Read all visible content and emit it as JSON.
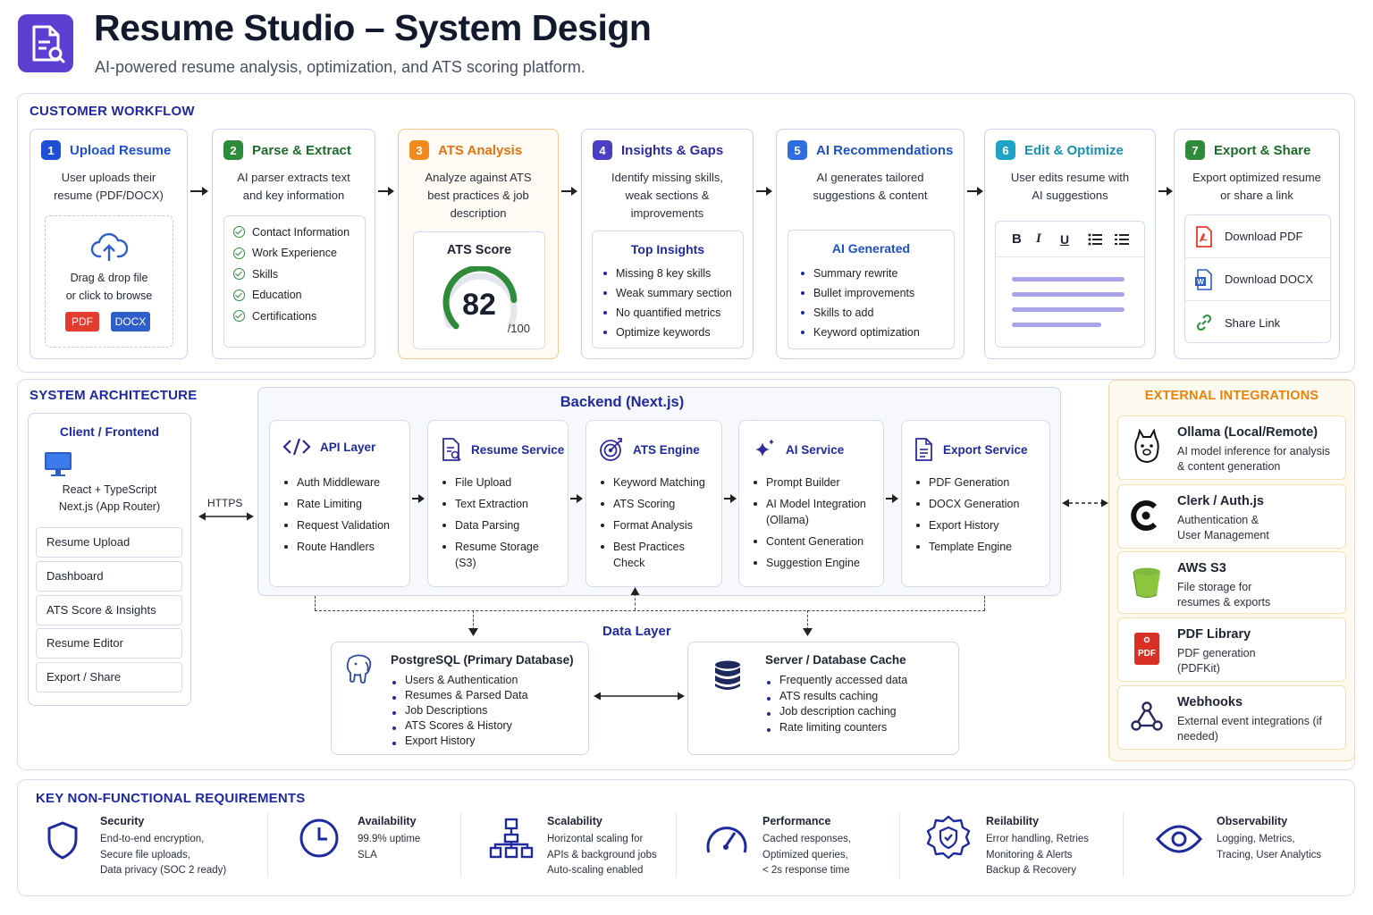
{
  "header": {
    "title": "Resume Studio – System Design",
    "subtitle": "AI-powered resume analysis, optimization, and ATS scoring platform."
  },
  "workflow": {
    "title": "CUSTOMER WORKFLOW",
    "steps": [
      {
        "num": "1",
        "title": "Upload Resume",
        "desc": "User uploads their resume (PDF/DOCX)"
      },
      {
        "num": "2",
        "title": "Parse & Extract",
        "desc": "AI parser extracts text and key information"
      },
      {
        "num": "3",
        "title": "ATS Analysis",
        "desc": "Analyze against ATS best practices & job description"
      },
      {
        "num": "4",
        "title": "Insights & Gaps",
        "desc": "Identify missing skills, weak sections & improvements"
      },
      {
        "num": "5",
        "title": "AI Recommendations",
        "desc": "AI generates tailored suggestions & content"
      },
      {
        "num": "6",
        "title": "Edit & Optimize",
        "desc": "User edits resume with AI suggestions"
      },
      {
        "num": "7",
        "title": "Export & Share",
        "desc": "Export optimized resume or share a link"
      }
    ],
    "upload": {
      "line1": "Drag & drop file",
      "line2": "or click to browse",
      "pdf": "PDF",
      "docx": "DOCX"
    },
    "parse_items": [
      "Contact Information",
      "Work Experience",
      "Skills",
      "Education",
      "Certifications"
    ],
    "ats": {
      "label": "ATS Score",
      "score": "82",
      "max": "/100",
      "fraction": 0.82
    },
    "insights": {
      "title": "Top Insights",
      "items": [
        "Missing 8 key skills",
        "Weak summary section",
        "No quantified metrics",
        "Optimize keywords"
      ]
    },
    "ai_generated": {
      "title": "AI Generated",
      "items": [
        "Summary rewrite",
        "Bullet improvements",
        "Skills to add",
        "Keyword optimization"
      ]
    },
    "editor": {
      "bold": "B",
      "italic": "I",
      "underline": "U"
    },
    "export": {
      "pdf": "Download PDF",
      "docx": "Download DOCX",
      "share": "Share Link",
      "docx_glyph": "W"
    }
  },
  "architecture": {
    "title": "SYSTEM ARCHITECTURE",
    "client": {
      "title": "Client / Frontend",
      "stack1": "React + TypeScript",
      "stack2": "Next.js (App Router)",
      "items": [
        "Resume Upload",
        "Dashboard",
        "ATS Score & Insights",
        "Resume Editor",
        "Export / Share"
      ]
    },
    "https": "HTTPS",
    "backend": {
      "title": "Backend (Next.js)",
      "services": [
        {
          "title": "API Layer",
          "items": [
            "Auth Middleware",
            "Rate Limiting",
            "Request Validation",
            "Route Handlers"
          ]
        },
        {
          "title": "Resume Service",
          "items": [
            "File Upload",
            "Text Extraction",
            "Data Parsing",
            "Resume Storage (S3)"
          ]
        },
        {
          "title": "ATS Engine",
          "items": [
            "Keyword Matching",
            "ATS Scoring",
            "Format Analysis",
            "Best Practices Check"
          ]
        },
        {
          "title": "AI Service",
          "items": [
            "Prompt Builder",
            "AI Model Integration (Ollama)",
            "Content Generation",
            "Suggestion Engine"
          ]
        },
        {
          "title": "Export Service",
          "items": [
            "PDF Generation",
            "DOCX Generation",
            "Export History",
            "Template Engine"
          ]
        }
      ]
    },
    "data_layer": {
      "title": "Data Layer",
      "postgres": {
        "title": "PostgreSQL (Primary Database)",
        "items": [
          "Users & Authentication",
          "Resumes & Parsed Data",
          "Job Descriptions",
          "ATS Scores & History",
          "Export History"
        ]
      },
      "cache": {
        "title": "Server / Database Cache",
        "items": [
          "Frequently accessed data",
          "ATS results caching",
          "Job description caching",
          "Rate limiting counters"
        ]
      }
    }
  },
  "integrations": {
    "title": "EXTERNAL INTEGRATIONS",
    "items": [
      {
        "title": "Ollama (Local/Remote)",
        "desc": "AI model inference for analysis & content generation",
        "icon": "llama-icon"
      },
      {
        "title": "Clerk / Auth.js",
        "desc": "Authentication & User Management",
        "icon": "clerk-icon"
      },
      {
        "title": "AWS S3",
        "desc": "File storage for resumes & exports",
        "icon": "bucket-icon"
      },
      {
        "title": "PDF Library",
        "desc": "PDF generation (PDFKit)",
        "icon": "pdf-file-icon",
        "glyph": "PDF"
      },
      {
        "title": "Webhooks",
        "desc": "External event integrations (if needed)",
        "icon": "webhook-icon"
      }
    ]
  },
  "nfr": {
    "title": "KEY NON-FUNCTIONAL REQUIREMENTS",
    "items": [
      {
        "title": "Security",
        "lines": [
          "End-to-end encryption,",
          "Secure file uploads,",
          "Data privacy (SOC 2 ready)"
        ]
      },
      {
        "title": "Availability",
        "lines": [
          "99.9% uptime",
          "SLA"
        ]
      },
      {
        "title": "Scalability",
        "lines": [
          "Horizontal scaling for",
          "APIs & background jobs",
          "Auto-scaling enabled"
        ]
      },
      {
        "title": "Performance",
        "lines": [
          "Cached responses,",
          "Optimized queries,",
          "< 2s response time"
        ]
      },
      {
        "title": "Reilability",
        "lines": [
          "Error handling, Retries",
          "Monitoring & Alerts",
          "Backup & Recovery"
        ]
      },
      {
        "title": "Observability",
        "lines": [
          "Logging, Metrics,",
          "Tracing, User Analytics"
        ]
      }
    ]
  },
  "colors": {
    "navy": "#1e2a9e",
    "step_colors": [
      "#1f4fd8",
      "#2e8b3a",
      "#f08a1c",
      "#4a3fc4",
      "#2f6ee0",
      "#1ea3c4",
      "#2e8b3a"
    ],
    "ats_green": "#2e8b3a",
    "integration_accent": "#e8820c"
  }
}
